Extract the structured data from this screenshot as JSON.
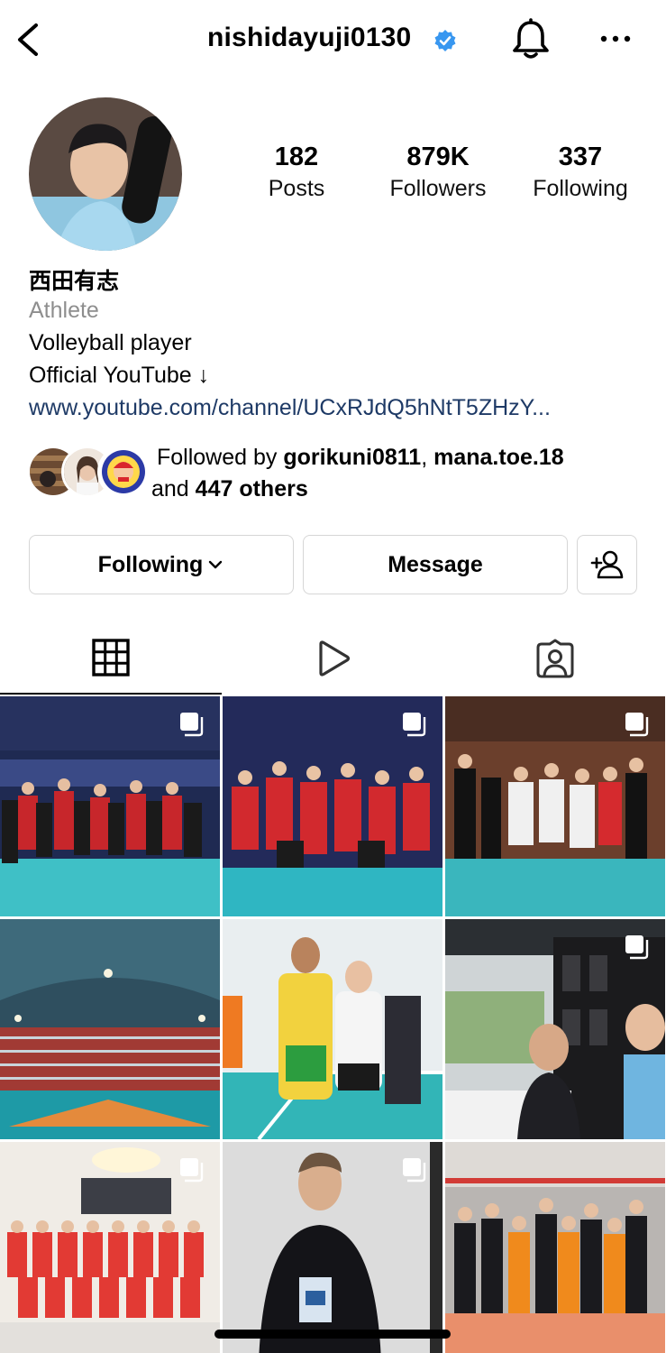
{
  "header": {
    "username": "nishidayuji0130",
    "verified_icon": "verified-badge-icon",
    "accent_color": "#3897f0"
  },
  "profile": {
    "stats": {
      "posts": {
        "value": "182",
        "label": "Posts"
      },
      "followers": {
        "value": "879K",
        "label": "Followers"
      },
      "following": {
        "value": "337",
        "label": "Following"
      }
    },
    "full_name": "西田有志",
    "category": "Athlete",
    "bio_line1": "Volleyball player",
    "bio_line2": "Official YouTube ↓",
    "link": "www.youtube.com/channel/UCxRJdQ5hNtT5ZHzY..."
  },
  "followed_by": {
    "prefix": "Followed by ",
    "user1": "gorikuni0811",
    "separator": ", ",
    "user2": "mana.toe.18",
    "and_text": " and ",
    "others": "447 others"
  },
  "actions": {
    "following_label": "Following",
    "message_label": "Message"
  },
  "tabs": [
    {
      "name": "posts-grid",
      "icon": "grid-icon",
      "selected": true
    },
    {
      "name": "reels",
      "icon": "play-icon",
      "selected": false
    },
    {
      "name": "tagged",
      "icon": "tagged-person-icon",
      "selected": false
    }
  ],
  "posts": [
    {
      "description": "team photo in arena",
      "multi": true
    },
    {
      "description": "team celebrating on court",
      "multi": true
    },
    {
      "description": "players posing with opponents",
      "multi": true
    },
    {
      "description": "empty stadium interior",
      "multi": false
    },
    {
      "description": "two players posing",
      "multi": false
    },
    {
      "description": "restaurant selfie",
      "multi": true
    },
    {
      "description": "official team photo",
      "multi": true
    },
    {
      "description": "player holding product",
      "multi": true
    },
    {
      "description": "team group photo",
      "multi": false
    }
  ]
}
